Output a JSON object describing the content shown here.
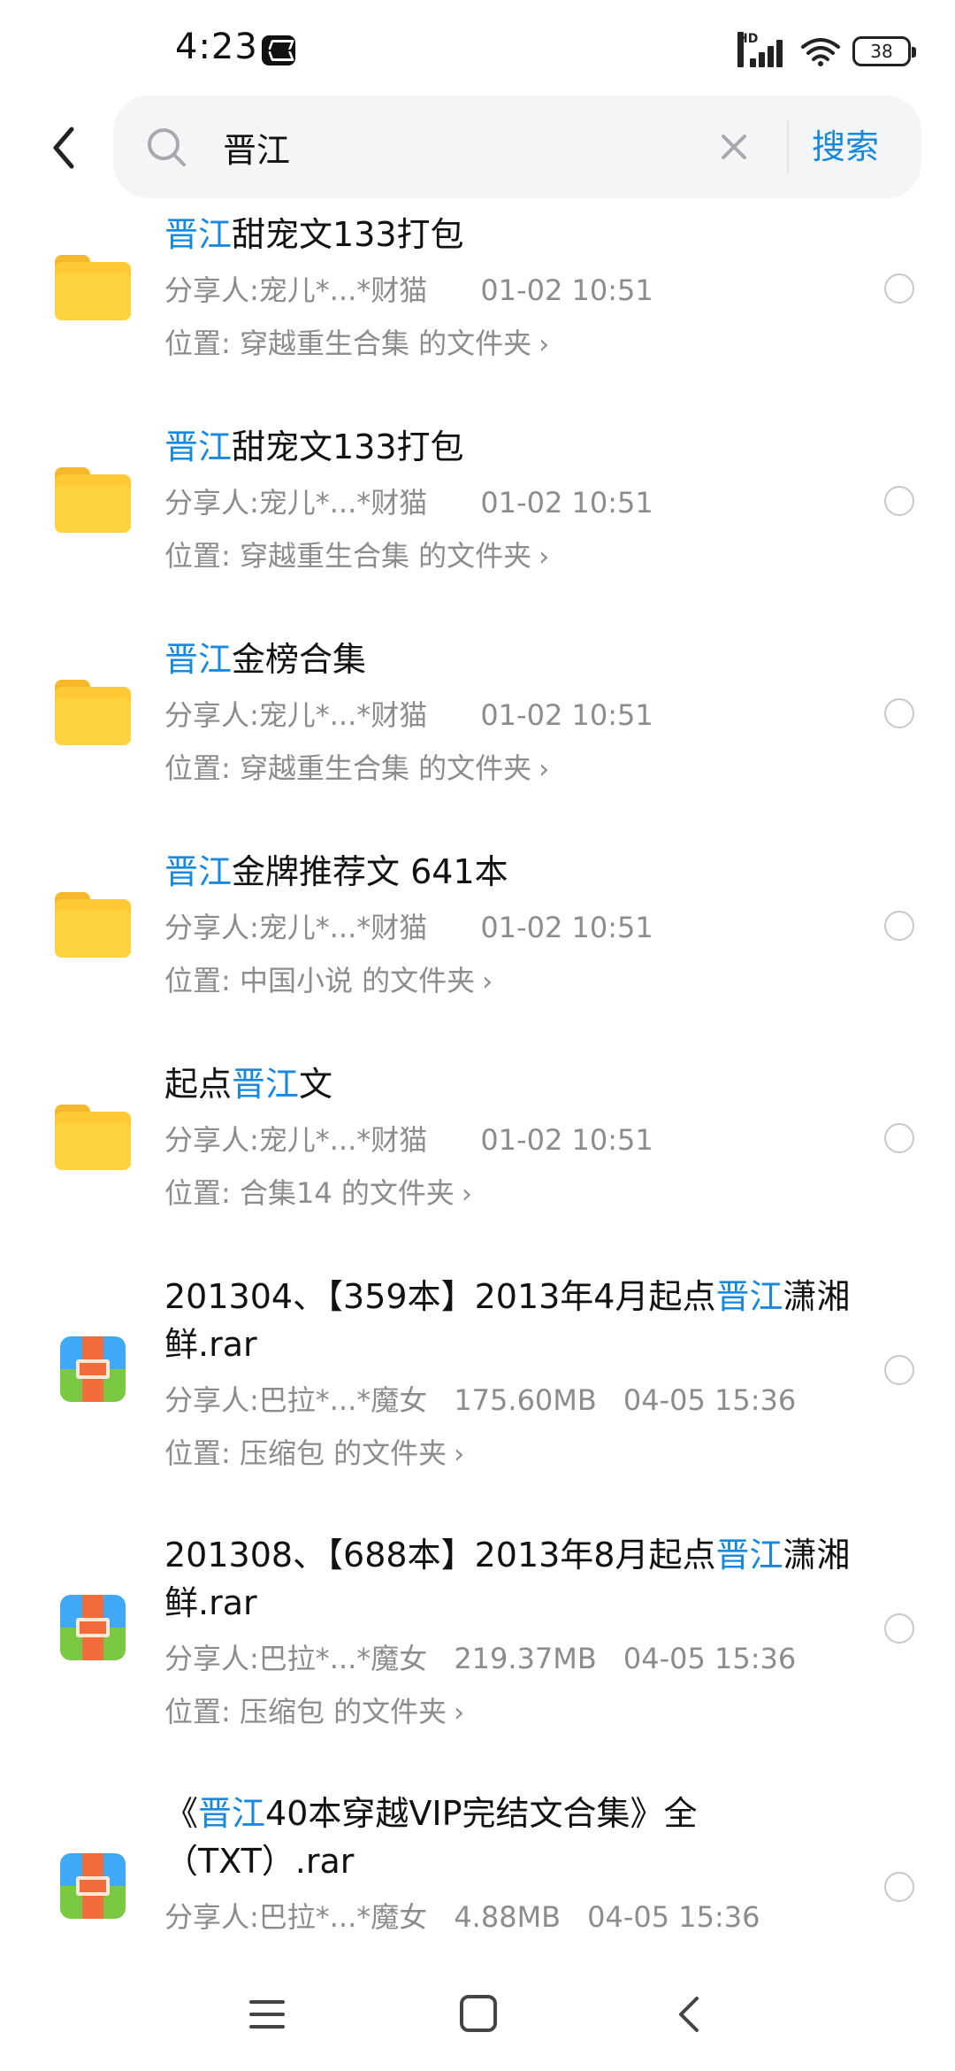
{
  "status_bar": {
    "time": "4:23",
    "hd": "HD",
    "battery": "38",
    "icons": [
      "capcut-icon",
      "signal-icon",
      "wifi-icon",
      "battery-icon"
    ]
  },
  "search": {
    "query": "晋江",
    "button_label": "搜索",
    "icons": [
      "back-icon",
      "search-icon",
      "clear-icon"
    ]
  },
  "colors": {
    "accent": "#1688e0",
    "meta_text": "#8c8c8c",
    "folder": "#ffc933"
  },
  "results": [
    {
      "type": "folder",
      "title_pre": "",
      "title_hl": "晋江",
      "title_post": "甜宠文133打包",
      "sharer": "分享人:宠儿*...*财猫",
      "size": "",
      "time": "01-02 10:51",
      "location": "位置:  穿越重生合集 的文件夹"
    },
    {
      "type": "folder",
      "title_pre": "",
      "title_hl": "晋江",
      "title_post": "甜宠文133打包",
      "sharer": "分享人:宠儿*...*财猫",
      "size": "",
      "time": "01-02 10:51",
      "location": "位置:  穿越重生合集 的文件夹"
    },
    {
      "type": "folder",
      "title_pre": "",
      "title_hl": "晋江",
      "title_post": "金榜合集",
      "sharer": "分享人:宠儿*...*财猫",
      "size": "",
      "time": "01-02 10:51",
      "location": "位置:  穿越重生合集 的文件夹"
    },
    {
      "type": "folder",
      "title_pre": "",
      "title_hl": "晋江",
      "title_post": "金牌推荐文 641本",
      "sharer": "分享人:宠儿*...*财猫",
      "size": "",
      "time": "01-02 10:51",
      "location": "位置:  中国小说 的文件夹"
    },
    {
      "type": "folder",
      "title_pre": "起点",
      "title_hl": "晋江",
      "title_post": "文",
      "sharer": "分享人:宠儿*...*财猫",
      "size": "",
      "time": "01-02 10:51",
      "location": "位置:  合集14 的文件夹"
    },
    {
      "type": "rar",
      "title_pre": "201304、【359本】2013年4月起点",
      "title_hl": "晋江",
      "title_post": "潇湘鲜.rar",
      "sharer": "分享人:巴拉*...*魔女",
      "size": "175.60MB",
      "time": "04-05 15:36",
      "location": "位置:  压缩包 的文件夹"
    },
    {
      "type": "rar",
      "title_pre": "201308、【688本】2013年8月起点",
      "title_hl": "晋江",
      "title_post": "潇湘鲜.rar",
      "sharer": "分享人:巴拉*...*魔女",
      "size": "219.37MB",
      "time": "04-05 15:36",
      "location": "位置:  压缩包 的文件夹"
    },
    {
      "type": "rar",
      "title_pre": "《",
      "title_hl": "晋江",
      "title_post": "40本穿越VIP完结文合集》全（TXT）.rar",
      "sharer": "分享人:巴拉*...*魔女",
      "size": "4.88MB",
      "time": "04-05 15:36",
      "location": ""
    }
  ],
  "nav_bar": {
    "icons": [
      "menu-icon",
      "home-icon",
      "back-nav-icon"
    ]
  }
}
